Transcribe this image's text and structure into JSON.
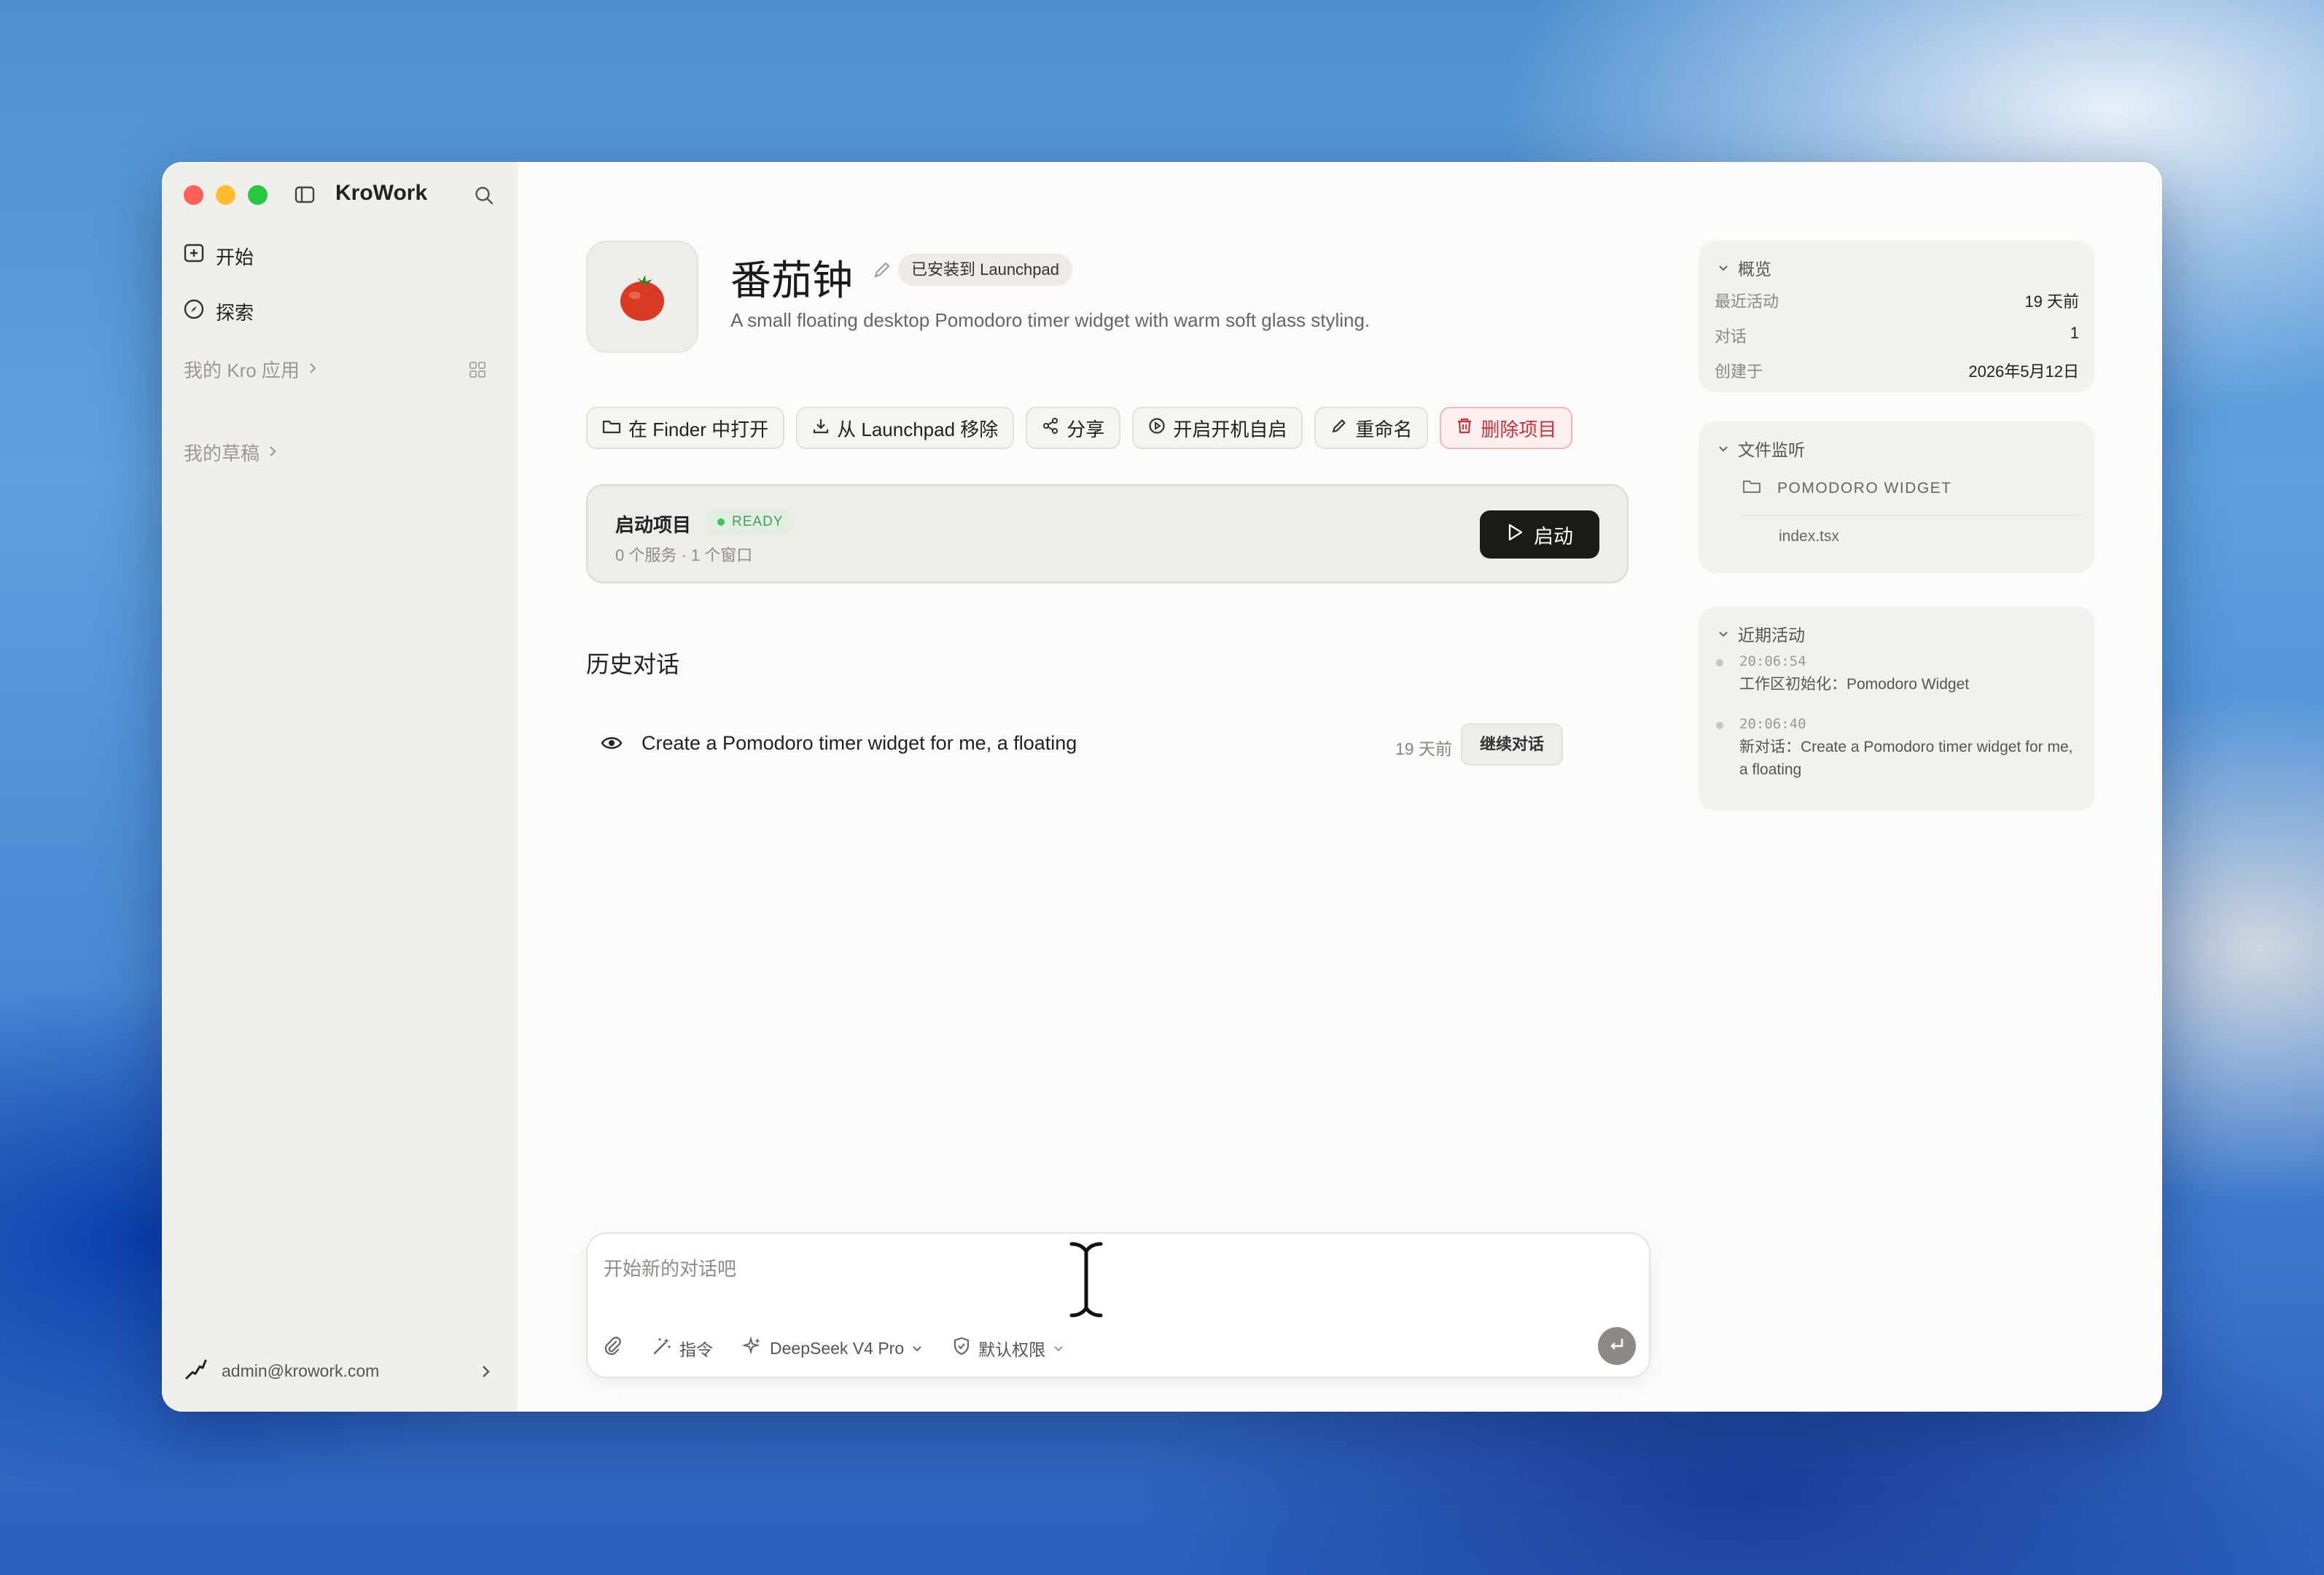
{
  "app": {
    "title": "KroWork"
  },
  "sidebar": {
    "nav": [
      {
        "label": "开始"
      },
      {
        "label": "探索"
      }
    ],
    "sections": [
      {
        "label": "我的 Kro 应用"
      },
      {
        "label": "我的草稿"
      }
    ],
    "user": {
      "email": "admin@krowork.com"
    }
  },
  "project": {
    "name": "番茄钟",
    "installed_badge": "已安装到 Launchpad",
    "description": "A small floating desktop Pomodoro timer widget with warm soft glass styling.",
    "actions": [
      {
        "label": "在 Finder 中打开",
        "icon": "folder-icon"
      },
      {
        "label": "从 Launchpad 移除",
        "icon": "download-icon"
      },
      {
        "label": "分享",
        "icon": "share-icon"
      },
      {
        "label": "开启开机自启",
        "icon": "play-circle-icon"
      },
      {
        "label": "重命名",
        "icon": "pencil-icon"
      },
      {
        "label": "删除项目",
        "icon": "trash-icon",
        "danger": true
      }
    ]
  },
  "launch": {
    "title": "启动项目",
    "status": "READY",
    "subtitle": "0 个服务 · 1 个窗口",
    "button_label": "启动"
  },
  "history": {
    "title": "历史对话",
    "items": [
      {
        "text": "Create a Pomodoro timer widget for me, a floating",
        "time": "19 天前",
        "action": "继续对话"
      }
    ]
  },
  "overview": {
    "title": "概览",
    "rows": [
      {
        "key": "最近活动",
        "value": "19 天前"
      },
      {
        "key": "对话",
        "value": "1"
      },
      {
        "key": "创建于",
        "value": "2026年5月12日"
      }
    ]
  },
  "files": {
    "title": "文件监听",
    "folder": "POMODORO WIDGET",
    "items": [
      "index.tsx"
    ]
  },
  "activity": {
    "title": "近期活动",
    "items": [
      {
        "time": "20:06:54",
        "text": "工作区初始化：Pomodoro Widget"
      },
      {
        "time": "20:06:40",
        "text": "新对话：Create a Pomodoro timer widget for me, a floating"
      }
    ]
  },
  "composer": {
    "placeholder": "开始新的对话吧",
    "command_label": "指令",
    "model_label": "DeepSeek V4 Pro",
    "permission_label": "默认权限"
  },
  "colors": {
    "accent_dark": "#1c1a17",
    "danger": "#d0313a",
    "ready": "#3e9f5a"
  }
}
